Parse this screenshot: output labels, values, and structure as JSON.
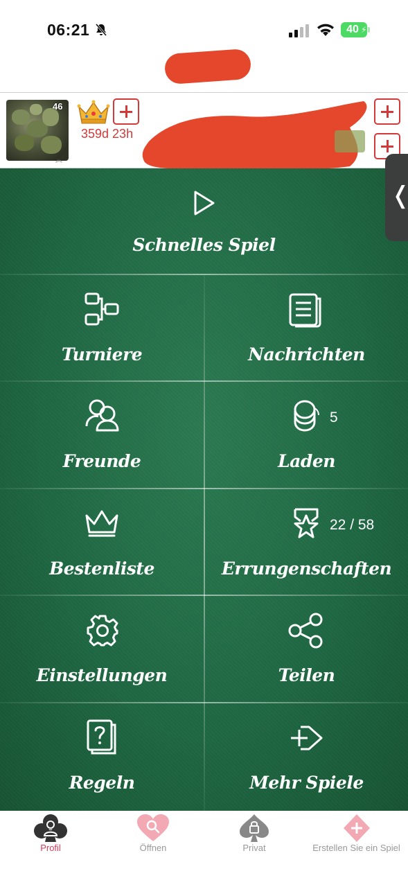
{
  "status_bar": {
    "time": "06:21",
    "battery": "40"
  },
  "header": {
    "level": "46",
    "vip_time": "359d 23h"
  },
  "menu": {
    "quick_game": "Schnelles Spiel",
    "tiles": [
      {
        "label": "Turniere",
        "icon": "tournament-bracket-icon"
      },
      {
        "label": "Nachrichten",
        "icon": "messages-icon"
      },
      {
        "label": "Freunde",
        "icon": "friends-icon"
      },
      {
        "label": "Laden",
        "icon": "coins-icon",
        "extra": "5"
      },
      {
        "label": "Bestenliste",
        "icon": "crown-icon"
      },
      {
        "label": "Errungenschaften",
        "icon": "achievement-star-icon",
        "extra": "22 / 58"
      },
      {
        "label": "Einstellungen",
        "icon": "gear-icon"
      },
      {
        "label": "Teilen",
        "icon": "share-icon"
      },
      {
        "label": "Regeln",
        "icon": "rules-question-icon"
      },
      {
        "label": "Mehr Spiele",
        "icon": "more-games-icon"
      }
    ]
  },
  "bottom_nav": {
    "items": [
      {
        "label": "Profil",
        "icon": "club-profile-icon",
        "color": "#e0395a",
        "active": true
      },
      {
        "label": "Öffnen",
        "icon": "heart-search-icon",
        "color": "#f2a9b4"
      },
      {
        "label": "Privat",
        "icon": "spade-lock-icon",
        "color": "#888888"
      },
      {
        "label": "Erstellen Sie ein Spiel",
        "icon": "diamond-plus-icon",
        "color": "#f2a9b4"
      }
    ]
  },
  "colors": {
    "accent_red": "#d23a3a",
    "felt_green": "#1f6843",
    "nav_active": "#e0395a"
  }
}
